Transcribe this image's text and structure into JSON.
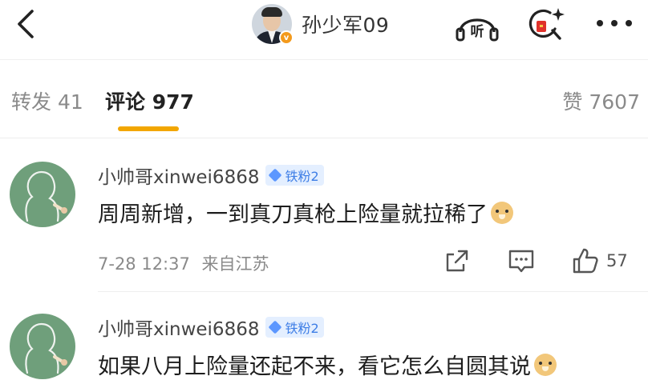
{
  "header": {
    "back_icon": "chevron-left-icon",
    "username": "孙少军09",
    "verified_badge": "v",
    "listen_icon": "listen-headphones-icon",
    "search_icon": "sparkle-search-icon",
    "more_icon": "more-dots-icon"
  },
  "tabs": {
    "repost": "转发 41",
    "comments": "评论 977",
    "likes": "赞 7607",
    "active_color": "#f2a600"
  },
  "comments": [
    {
      "name": "小帅哥xinwei6868",
      "badge": "铁粉2",
      "text": "周周新增，一到真刀真枪上险量就拉稀了",
      "emoji": "doge-emoji",
      "time": "7-28 12:37",
      "location": "来自江苏",
      "likes": "57"
    },
    {
      "name": "小帅哥xinwei6868",
      "badge": "铁粉2",
      "text": "如果八月上险量还起不来，看它怎么自圆其说",
      "emoji": "doge-emoji"
    }
  ],
  "colors": {
    "avatar_green": "#6f9f7b",
    "badge_bg": "#e4efff",
    "badge_text": "#3e7ee6",
    "verified_orange": "#f39a1c"
  }
}
